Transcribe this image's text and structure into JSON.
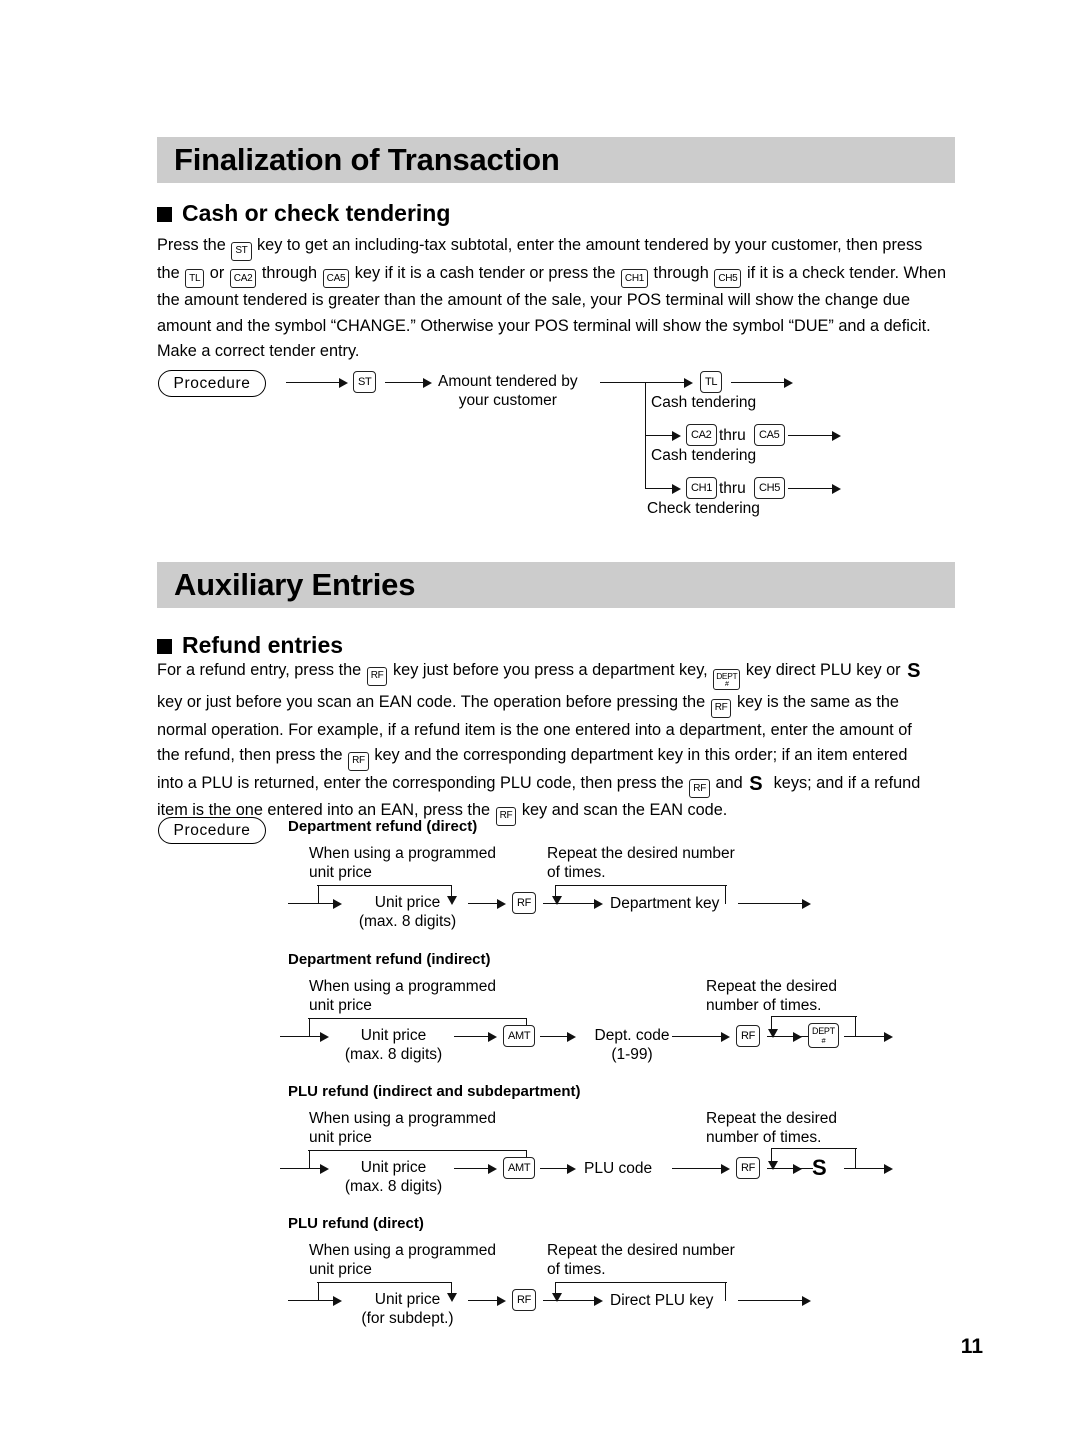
{
  "page": {
    "number": "11"
  },
  "sections": [
    {
      "banner_title": "Finalization of Transaction",
      "subhead": "Cash or check tendering"
    },
    {
      "banner_title": "Auxiliary Entries",
      "subhead": "Refund entries"
    }
  ],
  "paragraph1": {
    "l1a": "Press the",
    "k1": "ST",
    "l1b": "key to get an including-tax subtotal, enter the amount tendered by your customer, then press",
    "l2a": "the",
    "k2": "TL",
    "l2b": "or",
    "k3": "CA2",
    "l2c": "through",
    "k4": "CA5",
    "l2d": "key if it is a cash tender or press the",
    "k5": "CH1",
    "l2e": "through",
    "k6": "CH5",
    "l2f": "if it is a check tender. When",
    "l3": "the amount tendered is greater than the amount of the sale, your POS terminal will show the change due",
    "l4": "amount and the symbol “CHANGE.” Otherwise your POS terminal will show the symbol “DUE” and a deficit.",
    "l5": "Make a correct tender entry."
  },
  "paragraph2": {
    "l1a": "For a refund entry, press the",
    "k1": "RF",
    "l1b": "key just before you press a department key,",
    "k2_line1": "DEPT",
    "k2_line2": "#",
    "l1c": "key direct PLU key or",
    "k3": "S",
    "l2a": "key or just before you scan an EAN code. The operation before pressing the",
    "k4": "RF",
    "l2b": "key is the same as the",
    "l3": "normal operation. For example, if a refund item is the one entered into a department, enter the amount of",
    "l4a": "the refund, then press the",
    "k5": "RF",
    "l4b": "key and the corresponding department key in this order; if an item entered",
    "l5a": "into a PLU is returned, enter the corresponding PLU code, then press the",
    "k6": "RF",
    "l5b": "and",
    "k7": "S",
    "l5c": "keys; and if a refund",
    "l6a": "item is the one entered into an EAN, press the",
    "k8": "RF",
    "l6b": "key and scan the EAN code."
  },
  "procedure_label": "Procedure",
  "diagram1": {
    "key_st": "ST",
    "node_amount_l1": "Amount tendered by",
    "node_amount_l2": "your customer",
    "branch1": {
      "key": "TL",
      "caption": "Cash tendering"
    },
    "branch2": {
      "key_from": "CA2",
      "thru": "thru",
      "key_to": "CA5",
      "caption": "Cash tendering"
    },
    "branch3": {
      "key_from": "CH1",
      "thru": "thru",
      "key_to": "CH5",
      "caption": "Check tendering"
    }
  },
  "diagram2": {
    "title": "Department refund (direct)",
    "note_left_l1": "When using a programmed",
    "note_left_l2": "unit price",
    "note_right_l1": "Repeat the desired number",
    "note_right_l2": "of times.",
    "node1_l1": "Unit price",
    "node1_l2": "(max. 8 digits)",
    "key_rf": "RF",
    "node2": "Department key"
  },
  "diagram3": {
    "title": "Department refund (indirect)",
    "note_left_l1": "When using a programmed",
    "note_left_l2": "unit price",
    "note_right_l1": "Repeat the desired",
    "note_right_l2": "number of times.",
    "node1_l1": "Unit price",
    "node1_l2": "(max. 8 digits)",
    "key_amt": "AMT",
    "node2_l1": "Dept. code",
    "node2_l2": "(1-99)",
    "key_rf": "RF",
    "key_dept_l1": "DEPT",
    "key_dept_l2": "#"
  },
  "diagram4": {
    "title": "PLU refund (indirect and subdepartment)",
    "note_left_l1": "When using a programmed",
    "note_left_l2": "unit price",
    "note_right_l1": "Repeat the desired",
    "note_right_l2": "number of times.",
    "node1_l1": "Unit price",
    "node1_l2": "(max. 8 digits)",
    "key_amt": "AMT",
    "node2": "PLU code",
    "key_rf": "RF",
    "key_s": "S"
  },
  "diagram5": {
    "title": "PLU refund (direct)",
    "note_left_l1": "When using a programmed",
    "note_left_l2": "unit price",
    "note_right_l1": "Repeat the desired number",
    "note_right_l2": "of times.",
    "node1_l1": "Unit price",
    "node1_l2": "(for subdept.)",
    "key_rf": "RF",
    "node2": "Direct PLU key"
  },
  "colors": {
    "banner_bg": "#cccccc",
    "text": "#000000",
    "line": "#111111"
  }
}
